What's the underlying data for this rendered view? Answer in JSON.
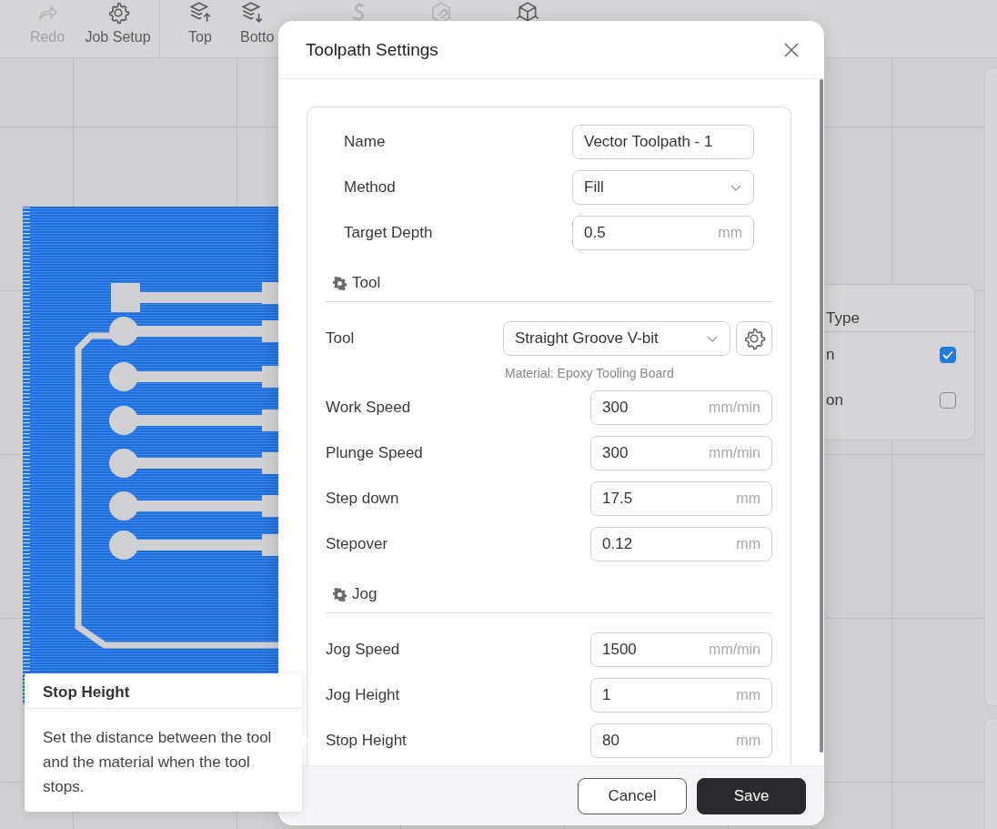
{
  "toolbar": [
    {
      "label": "Redo",
      "kind": "redo",
      "disabled": true
    },
    {
      "label": "Job Setup",
      "kind": "setup",
      "disabled": false
    },
    {
      "label": "Top",
      "kind": "top",
      "disabled": false
    },
    {
      "label": "Botto",
      "kind": "bottom",
      "disabled": false
    },
    {
      "kind": "dollar",
      "disabled": true
    },
    {
      "kind": "wrench",
      "disabled": true
    },
    {
      "kind": "cube",
      "disabled": false
    }
  ],
  "side_panel": {
    "title": "Type",
    "rows": [
      {
        "label": "n",
        "checked": true
      },
      {
        "label": "on",
        "checked": false
      }
    ]
  },
  "dialog": {
    "title": "Toolpath Settings",
    "fields": [
      {
        "label": "Name",
        "kind": "input",
        "value": "Vector Toolpath - 1"
      },
      {
        "label": "Method",
        "kind": "select",
        "value": "Fill"
      },
      {
        "label": "Target Depth",
        "kind": "input",
        "value": "0.5",
        "unit": "mm"
      }
    ],
    "sections": [
      {
        "title": "Tool",
        "rows": [
          {
            "label": "Tool",
            "kind": "tool-select",
            "value": "Straight Groove V-bit",
            "note": "Material: Epoxy Tooling Board"
          },
          {
            "label": "Work Speed",
            "kind": "input",
            "value": "300",
            "unit": "mm/min"
          },
          {
            "label": "Plunge Speed",
            "kind": "input",
            "value": "300",
            "unit": "mm/min"
          },
          {
            "label": "Step down",
            "kind": "input",
            "value": "17.5",
            "unit": "mm"
          },
          {
            "label": "Stepover",
            "kind": "input",
            "value": "0.12",
            "unit": "mm"
          }
        ]
      },
      {
        "title": "Jog",
        "rows": [
          {
            "label": "Jog Speed",
            "kind": "input",
            "value": "1500",
            "unit": "mm/min"
          },
          {
            "label": "Jog Height",
            "kind": "input",
            "value": "1",
            "unit": "mm"
          },
          {
            "label": "Stop Height",
            "kind": "input",
            "value": "80",
            "unit": "mm"
          }
        ]
      }
    ],
    "buttons": [
      {
        "label": "Cancel",
        "kind": "secondary"
      },
      {
        "label": "Save",
        "kind": "primary"
      }
    ]
  },
  "tooltip": {
    "title": "Stop Height",
    "text": "Set the distance between the tool and the material when the tool stops."
  }
}
